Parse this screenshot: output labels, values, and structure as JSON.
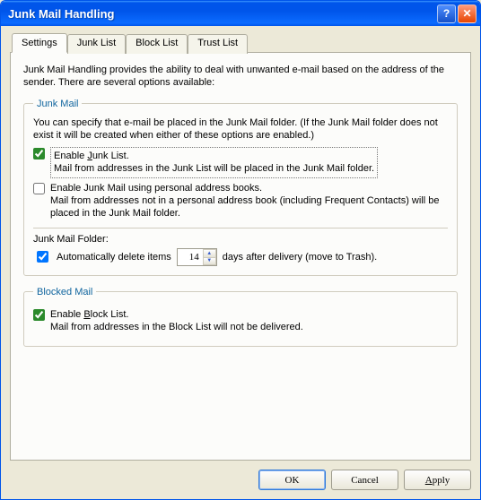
{
  "window": {
    "title": "Junk Mail Handling"
  },
  "tabs": [
    {
      "label": "Settings",
      "active": true
    },
    {
      "label": "Junk List",
      "active": false
    },
    {
      "label": "Block List",
      "active": false
    },
    {
      "label": "Trust List",
      "active": false
    }
  ],
  "intro": "Junk Mail Handling provides the ability to deal with unwanted e-mail based on the address of the sender.  There are several options available:",
  "junk": {
    "legend": "Junk Mail",
    "desc": "You can specify that e-mail be placed in the Junk Mail folder.  (If the Junk Mail folder does not exist it will be created when either of these options are enabled.)",
    "opt1": {
      "checked": true,
      "label_pre": "Enable ",
      "label_u": "J",
      "label_post": "unk List.",
      "sub": "Mail from addresses in the Junk List will be placed in the Junk Mail folder."
    },
    "opt2": {
      "checked": false,
      "label": "Enable Junk Mail using personal address books.",
      "sub": "Mail from addresses not in a personal address book (including Frequent Contacts) will be placed in the Junk Mail folder."
    },
    "folder_label": "Junk Mail Folder:",
    "auto": {
      "checked": true,
      "label": "Automatically delete items",
      "days": "14",
      "suffix": "days after delivery (move to Trash)."
    }
  },
  "blocked": {
    "legend": "Blocked Mail",
    "opt": {
      "checked": true,
      "label_pre": "Enable ",
      "label_u": "B",
      "label_post": "lock List.",
      "sub": "Mail from addresses in the Block List will not be delivered."
    }
  },
  "buttons": {
    "ok": "OK",
    "cancel": "Cancel",
    "apply_u": "A",
    "apply_post": "pply"
  }
}
